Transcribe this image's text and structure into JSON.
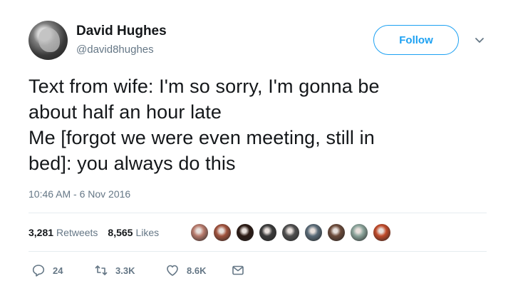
{
  "author": {
    "name": "David Hughes",
    "handle": "@david8hughes"
  },
  "follow_label": "Follow",
  "tweet": {
    "lines": [
      "Text from wife: I'm so sorry, I'm gonna be",
      "about half an hour late",
      "Me [forgot we were even meeting, still in",
      "bed]: you always do this"
    ],
    "timestamp": "10:46 AM - 6 Nov 2016"
  },
  "stats": {
    "retweets_count": "3,281",
    "retweets_label": "Retweets",
    "likes_count": "8,565",
    "likes_label": "Likes"
  },
  "liker_avatar_colors": [
    "#b77a6c",
    "#a0523d",
    "#2b1a14",
    "#3b3b3b",
    "#4f4f4f",
    "#5a6b78",
    "#6b4a3a",
    "#8aa39a",
    "#c04a2a"
  ],
  "actions": {
    "reply_count": "24",
    "retweet_count": "3.3K",
    "like_count": "8.6K"
  },
  "icons": {
    "avatar": "profile-photo",
    "caret": "chevron-down-icon",
    "reply": "reply-icon",
    "retweet": "retweet-icon",
    "like": "heart-icon",
    "message": "direct-message-icon"
  }
}
